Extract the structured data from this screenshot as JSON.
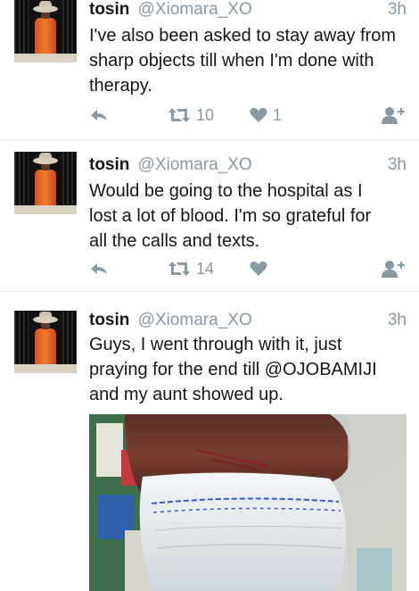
{
  "tweets": [
    {
      "name": "tosin",
      "handle": "@Xiomara_XO",
      "time": "3h",
      "lines": [
        "I've also been asked to stay away from",
        "sharp objects till when I'm done with",
        "therapy."
      ],
      "retweets": "10",
      "likes": "1"
    },
    {
      "name": "tosin",
      "handle": "@Xiomara_XO",
      "time": "3h",
      "lines": [
        "Would be going to the hospital as I",
        "lost a lot of blood. I'm so grateful for",
        "all the calls and texts."
      ],
      "retweets": "14",
      "likes": ""
    },
    {
      "name": "tosin",
      "handle": "@Xiomara_XO",
      "time": "3h",
      "lines": [
        "Guys, I went through with it, just",
        "praying for the end till @OJOBAMIJI",
        "and my aunt showed up."
      ],
      "media": "photo of a bandaged wrist"
    }
  ],
  "icons": {
    "reply": "reply-icon",
    "retweet": "retweet-icon",
    "like": "heart-icon",
    "follow": "follow-icon"
  },
  "colors": {
    "icon_gray": "#8899a6",
    "text": "#14171a",
    "divider": "#e1e8ed"
  }
}
